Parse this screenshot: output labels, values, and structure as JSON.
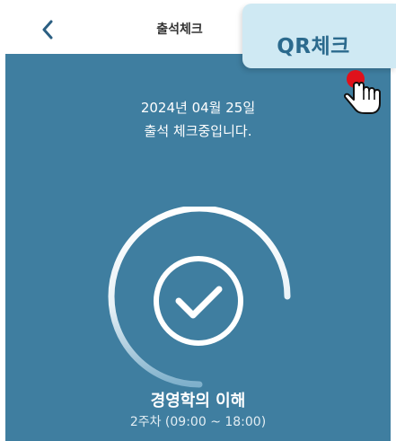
{
  "header": {
    "back_icon": "chevron-left-icon",
    "title": "출석체크"
  },
  "qr_button": {
    "label": "QR체크"
  },
  "attendance": {
    "date": "2024년 04월 25일",
    "status": "출석 체크중입니다.",
    "progress_icon": "check-icon",
    "course_name": "경영학의 이해",
    "course_schedule": "2주차 (09:00 ~ 18:00)"
  },
  "colors": {
    "panel": "#3f7ea0",
    "popup": "#cfe9f3",
    "accent": "#2b6a8d",
    "touch_dot": "#e0111b"
  }
}
